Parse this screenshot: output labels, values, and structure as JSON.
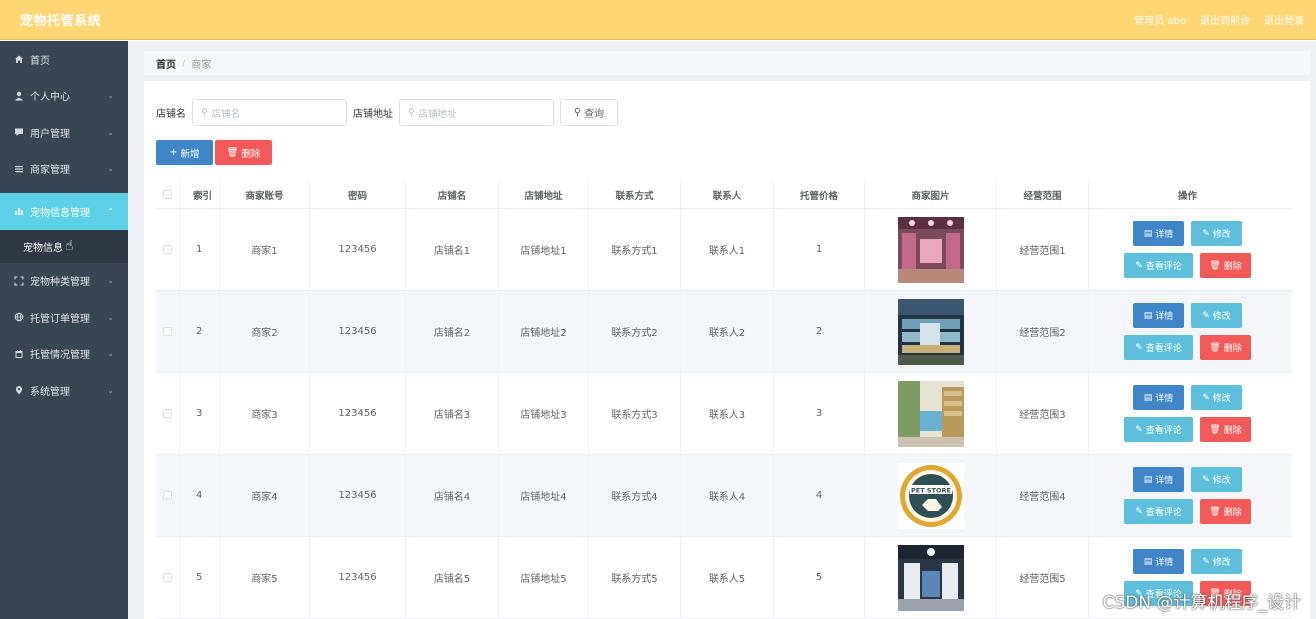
{
  "header": {
    "title": "宠物托管系统",
    "admin": "管理员 abo",
    "to_frontend": "退出到前台",
    "logout": "退出登录"
  },
  "sidebar": {
    "items": [
      {
        "label": "首页",
        "icon": "home-icon"
      },
      {
        "label": "个人中心",
        "icon": "user-icon"
      },
      {
        "label": "用户管理",
        "icon": "chat-icon"
      },
      {
        "label": "商家管理",
        "icon": "menu-icon"
      },
      {
        "label": "宠物信息管理",
        "icon": "chart-icon"
      },
      {
        "label": "宠物种类管理",
        "icon": "fullscreen-icon"
      },
      {
        "label": "托管订单管理",
        "icon": "globe-icon"
      },
      {
        "label": "托管情况管理",
        "icon": "calendar-icon"
      },
      {
        "label": "系统管理",
        "icon": "location-icon"
      }
    ],
    "sub_item": "宠物信息"
  },
  "breadcrumb": {
    "home": "首页",
    "sep": "/",
    "current": "商家"
  },
  "search": {
    "shop_name_label": "店铺名",
    "shop_name_placeholder": "店铺名",
    "shop_addr_label": "店铺地址",
    "shop_addr_placeholder": "店铺地址",
    "button": "查询"
  },
  "actions": {
    "add": "新增",
    "delete": "删除"
  },
  "table": {
    "headers": [
      "索引",
      "商家账号",
      "密码",
      "店铺名",
      "店铺地址",
      "联系方式",
      "联系人",
      "托管价格",
      "商家图片",
      "经营范围",
      "操作"
    ],
    "ops": {
      "detail": "详情",
      "edit": "修改",
      "comments": "查看评论",
      "delete": "删除"
    },
    "rows": [
      {
        "index": "1",
        "account": "商家1",
        "password": "123456",
        "shop": "店铺名1",
        "address": "店铺地址1",
        "contact": "联系方式1",
        "person": "联系人1",
        "price": "1",
        "scope": "经营范围1"
      },
      {
        "index": "2",
        "account": "商家2",
        "password": "123456",
        "shop": "店铺名2",
        "address": "店铺地址2",
        "contact": "联系方式2",
        "person": "联系人2",
        "price": "2",
        "scope": "经营范围2"
      },
      {
        "index": "3",
        "account": "商家3",
        "password": "123456",
        "shop": "店铺名3",
        "address": "店铺地址3",
        "contact": "联系方式3",
        "person": "联系人3",
        "price": "3",
        "scope": "经营范围3"
      },
      {
        "index": "4",
        "account": "商家4",
        "password": "123456",
        "shop": "店铺名4",
        "address": "店铺地址4",
        "contact": "联系方式4",
        "person": "联系人4",
        "price": "4",
        "scope": "经营范围4"
      },
      {
        "index": "5",
        "account": "商家5",
        "password": "123456",
        "shop": "店铺名5",
        "address": "店铺地址5",
        "contact": "联系方式5",
        "person": "联系人5",
        "price": "5",
        "scope": "经营范围5"
      }
    ]
  },
  "watermark": "CSDN @计算机程序_设计",
  "colors": {
    "topbar": "#fed674",
    "sidebar": "#3a4554",
    "sidebar_active": "#5cd0e6",
    "primary": "#3f86c8",
    "info": "#5ebfdd",
    "danger": "#f25a5a"
  }
}
